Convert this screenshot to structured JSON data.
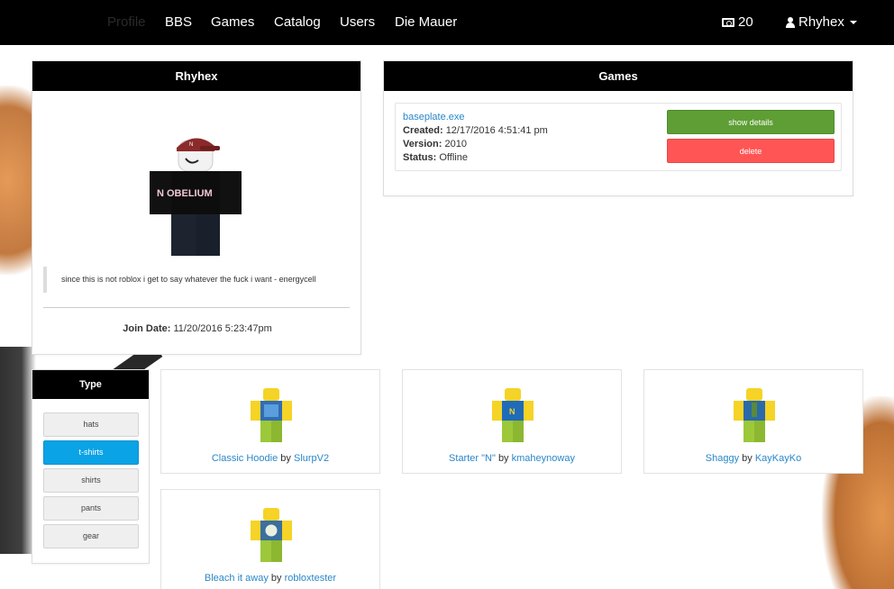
{
  "nav": {
    "links": [
      "Profile",
      "BBS",
      "Games",
      "Catalog",
      "Users",
      "Die Mauer"
    ],
    "currency": "20",
    "username": "Rhyhex"
  },
  "profile": {
    "title": "Rhyhex",
    "shirt_text": "N OBELIUM",
    "blurb": "since this is not roblox i get to say whatever the fuck i want - energycell",
    "join_label": "Join Date:",
    "join_value": "11/20/2016 5:23:47pm"
  },
  "games": {
    "title": "Games",
    "item": {
      "name": "baseplate.exe",
      "created_label": "Created:",
      "created_value": "12/17/2016 4:51:41 pm",
      "version_label": "Version:",
      "version_value": "2010",
      "status_label": "Status:",
      "status_value": "Offline",
      "details_button": "show details",
      "delete_button": "delete"
    }
  },
  "type_filter": {
    "title": "Type",
    "options": [
      "hats",
      "t-shirts",
      "shirts",
      "pants",
      "gear"
    ],
    "selected": "t-shirts"
  },
  "catalog": {
    "by_word": "by",
    "items": [
      {
        "name": "Classic Hoodie",
        "creator": "SlurpV2"
      },
      {
        "name": "Starter \"N\"",
        "creator": "kmaheynoway"
      },
      {
        "name": "Shaggy",
        "creator": "KayKayKo"
      },
      {
        "name": "Bleach it away",
        "creator": "robloxtester"
      }
    ]
  },
  "colors": {
    "accent_blue": "#2a87c8",
    "active_filter": "#0aa3e6",
    "details_green": "#5e9e35",
    "delete_red": "#ff5555",
    "header_black": "#000000"
  }
}
